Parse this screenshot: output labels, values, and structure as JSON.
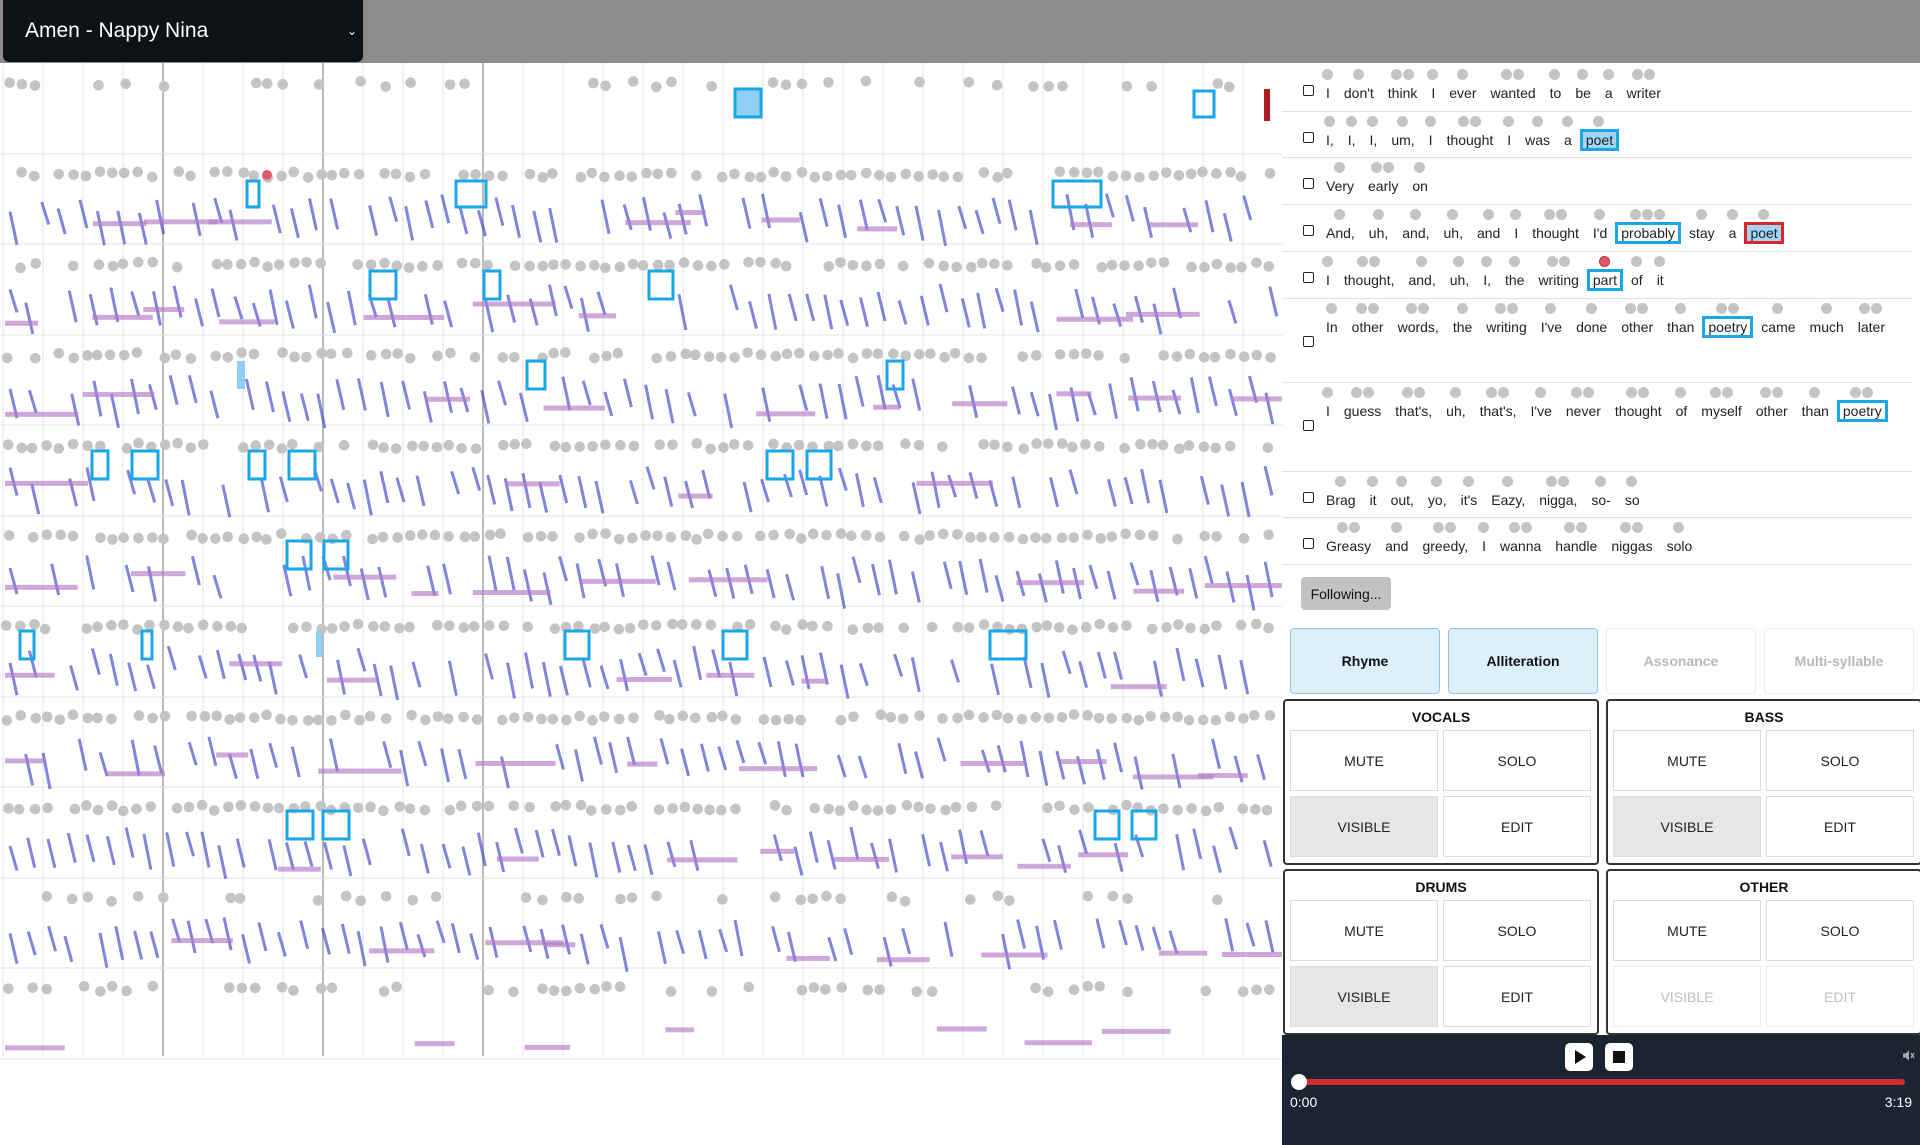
{
  "song": {
    "title": "Amen - Nappy Nina"
  },
  "lyrics": [
    {
      "words": [
        "I",
        "don't",
        "think",
        "I",
        "ever",
        "wanted",
        "to",
        "be",
        "a",
        "writer"
      ],
      "hl": {}
    },
    {
      "words": [
        "I,",
        "I,",
        "I,",
        "um,",
        "I",
        "thought",
        "I",
        "was",
        "a",
        "poet"
      ],
      "hl": {
        "9": "blue-fill"
      }
    },
    {
      "words": [
        "Very",
        "early",
        "on"
      ],
      "hl": {}
    },
    {
      "words": [
        "And,",
        "uh,",
        "and,",
        "uh,",
        "and",
        "I",
        "thought",
        "I'd",
        "probably",
        "stay",
        "a",
        "poet"
      ],
      "hl": {
        "8": "blue",
        "11": "red"
      }
    },
    {
      "words": [
        "I",
        "thought,",
        "and,",
        "uh,",
        "I,",
        "the",
        "writing",
        "part",
        "of",
        "it"
      ],
      "hl": {
        "7": "blue"
      }
    },
    {
      "words": [
        "In",
        "other",
        "words,",
        "the",
        "writing",
        "I've",
        "done",
        "other",
        "than",
        "poetry",
        "came",
        "much",
        "later"
      ],
      "hl": {
        "9": "blue"
      }
    },
    {
      "words": [
        "I",
        "guess",
        "that's,",
        "uh,",
        "that's,",
        "I've",
        "never",
        "thought",
        "of",
        "myself",
        "other",
        "than",
        "poetry"
      ],
      "hl": {
        "12": "blue"
      }
    },
    {
      "words": [
        "Brag",
        "it",
        "out,",
        "yo,",
        "it's",
        "Eazy,",
        "nigga,",
        "so-",
        "so"
      ],
      "hl": {}
    },
    {
      "words": [
        "Greasy",
        "and",
        "greedy,",
        "I",
        "wanna",
        "handle",
        "niggas",
        "solo"
      ],
      "hl": {}
    }
  ],
  "following": {
    "label": "Following..."
  },
  "modes": [
    {
      "label": "Rhyme",
      "active": true
    },
    {
      "label": "Alliteration",
      "active": true
    },
    {
      "label": "Assonance",
      "active": false
    },
    {
      "label": "Multi-syllable",
      "active": false
    }
  ],
  "tracks": [
    {
      "name": "VOCALS",
      "mute": "MUTE",
      "solo": "SOLO",
      "visible": "VISIBLE",
      "edit": "EDIT",
      "visible_on": true,
      "enabled": true
    },
    {
      "name": "BASS",
      "mute": "MUTE",
      "solo": "SOLO",
      "visible": "VISIBLE",
      "edit": "EDIT",
      "visible_on": true,
      "enabled": true
    },
    {
      "name": "DRUMS",
      "mute": "MUTE",
      "solo": "SOLO",
      "visible": "VISIBLE",
      "edit": "EDIT",
      "visible_on": true,
      "enabled": true
    },
    {
      "name": "OTHER",
      "mute": "MUTE",
      "solo": "SOLO",
      "visible": "VISIBLE",
      "edit": "EDIT",
      "visible_on": false,
      "enabled": false
    }
  ],
  "player": {
    "current": "0:00",
    "total": "3:19",
    "progress": 0.0
  },
  "colors": {
    "highlight_blue": "#1aa6e8",
    "highlight_red": "#e0242c",
    "note_blue": "#3a45c8",
    "note_purple": "#b47ac8",
    "dot_gray": "#c4c4c4"
  },
  "icons": {
    "dropdown": "chevron-down-icon",
    "play": "play-icon",
    "stop": "stop-icon",
    "mute": "speaker-mute-icon"
  }
}
